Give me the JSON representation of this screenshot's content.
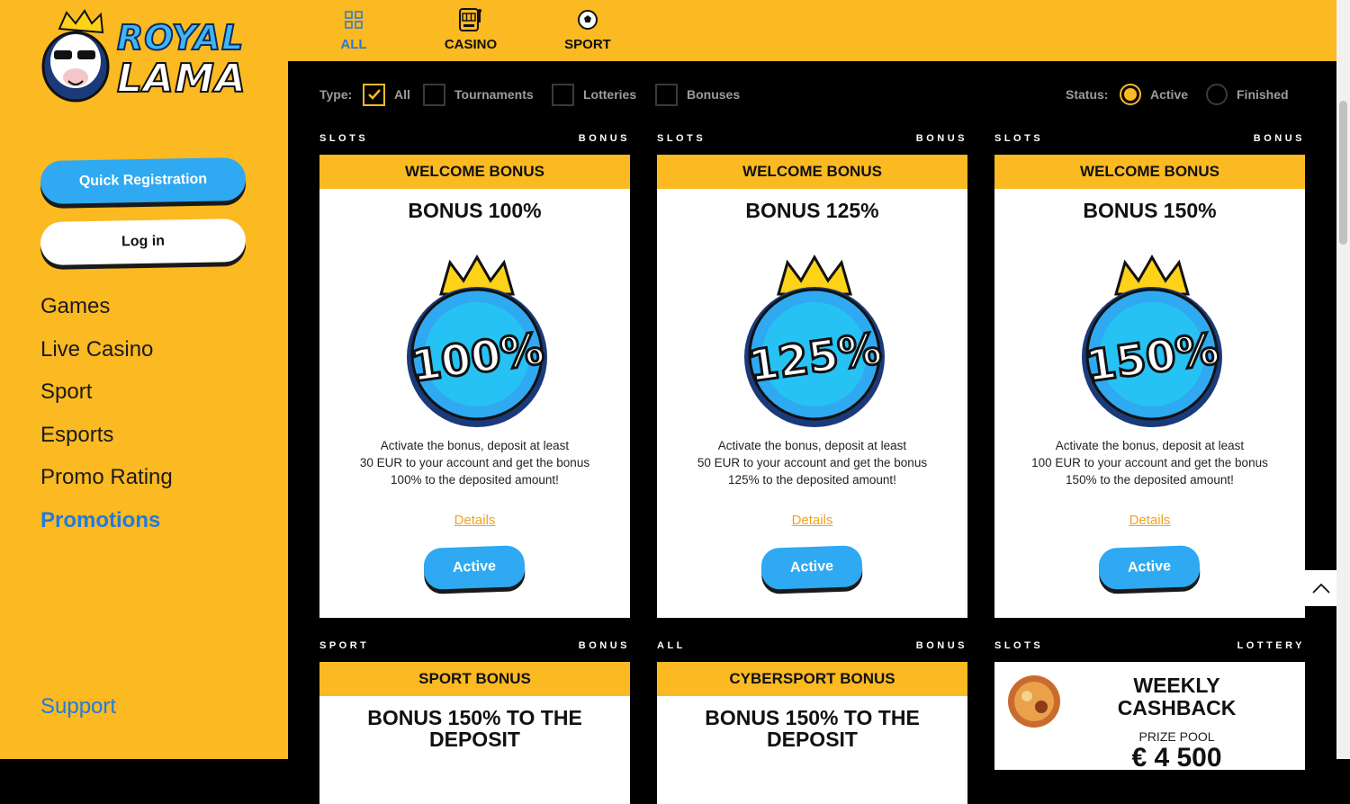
{
  "logo": {
    "line1": "ROYAL",
    "line2": "LAMA"
  },
  "sidebar": {
    "register_label": "Quick Registration",
    "login_label": "Log in",
    "nav": [
      {
        "label": "Games"
      },
      {
        "label": "Live Casino"
      },
      {
        "label": "Sport"
      },
      {
        "label": "Esports"
      },
      {
        "label": "Promo Rating"
      },
      {
        "label": "Promotions"
      }
    ],
    "support_label": "Support"
  },
  "tabs": [
    {
      "label": "ALL",
      "icon": "grid-icon",
      "active": true
    },
    {
      "label": "CASINO",
      "icon": "slot-machine-icon"
    },
    {
      "label": "SPORT",
      "icon": "soccer-ball-icon"
    }
  ],
  "filters": {
    "type_label": "Type:",
    "types": [
      "All",
      "Tournaments",
      "Lotteries",
      "Bonuses"
    ],
    "type_selected": "All",
    "status_label": "Status:",
    "statuses": [
      "Active",
      "Finished"
    ],
    "status_selected": "Active"
  },
  "cards": [
    {
      "category": "SLOTS",
      "kind": "BONUS",
      "header": "WELCOME BONUS",
      "title": "BONUS 100%",
      "coin": "100%",
      "desc1": "Activate the bonus, deposit at least",
      "desc2": "30 EUR to your account and get the bonus",
      "desc3": "100% to the deposited amount!",
      "details": "Details",
      "button": "Active"
    },
    {
      "category": "SLOTS",
      "kind": "BONUS",
      "header": "WELCOME BONUS",
      "title": "BONUS 125%",
      "coin": "125%",
      "desc1": "Activate the bonus, deposit at least",
      "desc2": "50 EUR to your account and get the bonus",
      "desc3": "125% to the deposited amount!",
      "details": "Details",
      "button": "Active"
    },
    {
      "category": "SLOTS",
      "kind": "BONUS",
      "header": "WELCOME BONUS",
      "title": "BONUS 150%",
      "coin": "150%",
      "desc1": "Activate the bonus, deposit at least",
      "desc2": "100 EUR to your account and get the bonus",
      "desc3": "150% to the deposited amount!",
      "details": "Details",
      "button": "Active"
    },
    {
      "category": "SPORT",
      "kind": "BONUS",
      "header": "SPORT BONUS",
      "title1": "BONUS 150% TO THE",
      "title2": "DEPOSIT"
    },
    {
      "category": "ALL",
      "kind": "BONUS",
      "header": "CYBERSPORT BONUS",
      "title1": "BONUS 150% TO THE",
      "title2": "DEPOSIT"
    },
    {
      "category": "SLOTS",
      "kind": "LOTTERY",
      "title1": "WEEKLY",
      "title2": "CASHBACK",
      "pool_label": "PRIZE POOL",
      "pool_value": "€ 4 500"
    }
  ],
  "colors": {
    "brand_yellow": "#fbb922",
    "accent_blue": "#2fa9f1",
    "link_orange": "#f4a21c"
  }
}
